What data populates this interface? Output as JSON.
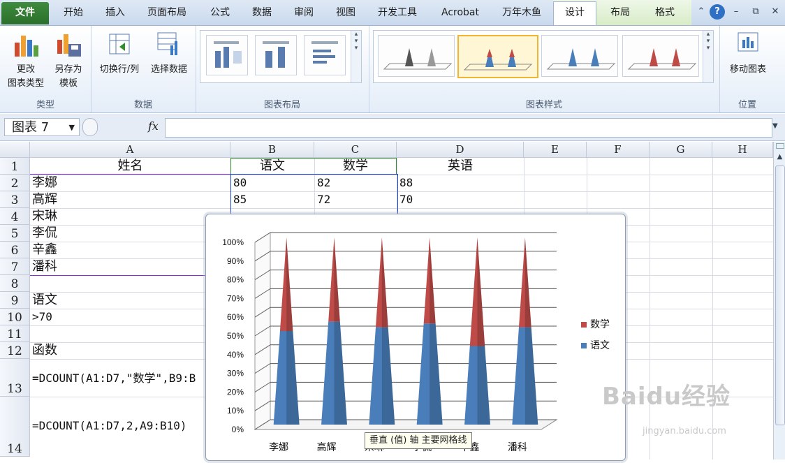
{
  "tabs": [
    "文件",
    "开始",
    "插入",
    "页面布局",
    "公式",
    "数据",
    "审阅",
    "视图",
    "开发工具",
    "Acrobat",
    "万年木鱼",
    "设计",
    "布局",
    "格式"
  ],
  "active_tab": "设计",
  "ribbon": {
    "groups": {
      "type": {
        "label": "类型",
        "change_type": "更改\n图表类型",
        "save_template": "另存为\n模板"
      },
      "data": {
        "label": "数据",
        "switch_row_col": "切换行/列",
        "select_data": "选择数据"
      },
      "layout": {
        "label": "图表布局"
      },
      "styles": {
        "label": "图表样式"
      },
      "location": {
        "label": "位置",
        "move_chart": "移动图表"
      }
    }
  },
  "formula_bar": {
    "name_box": "图表 7",
    "fx": "fx",
    "formula": ""
  },
  "columns": [
    "A",
    "B",
    "C",
    "D",
    "E",
    "F",
    "G",
    "H"
  ],
  "rows": [
    "1",
    "2",
    "3",
    "4",
    "5",
    "6",
    "7",
    "8",
    "9",
    "10",
    "11",
    "12",
    "13",
    "14"
  ],
  "cells": {
    "A1": "姓名",
    "B1": "语文",
    "C1": "数学",
    "D1": "英语",
    "A2": "李娜",
    "B2": "80",
    "C2": "82",
    "D2": "88",
    "A3": "高辉",
    "B3": "85",
    "C3": "72",
    "D3": "70",
    "A4": "宋琳",
    "A5": "李侃",
    "A6": "辛鑫",
    "A7": "潘科",
    "A9": "语文",
    "A10": ">70",
    "A12": "函数",
    "A13": "=DCOUNT(A1:D7,\"数学\",B9:B",
    "A14": "=DCOUNT(A1:D7,2,A9:B10)"
  },
  "chart_data": {
    "type": "bar",
    "stacked": "100%",
    "shape": "cone",
    "categories": [
      "李娜",
      "高辉",
      "宋琳",
      "李侃",
      "辛鑫",
      "潘科"
    ],
    "category_labels_visible": [
      "李娜",
      "高辉",
      "宋琳",
      "李侃",
      "辛鑫",
      "潘科"
    ],
    "y_ticks": [
      "0%",
      "10%",
      "20%",
      "30%",
      "40%",
      "50%",
      "60%",
      "70%",
      "80%",
      "90%",
      "100%"
    ],
    "ylim": [
      0,
      100
    ],
    "series": [
      {
        "name": "语文",
        "color": "#4a7ebb",
        "values": [
          50,
          55,
          52,
          54,
          42,
          52
        ]
      },
      {
        "name": "数学",
        "color": "#be4b48",
        "values": [
          50,
          45,
          48,
          46,
          58,
          48
        ]
      }
    ],
    "legend": [
      "数学",
      "语文"
    ],
    "legend_position": "right",
    "grid": true
  },
  "tooltip": "垂直 (值) 轴 主要网格线",
  "watermark": {
    "text": "Baidu经验",
    "url": "jingyan.baidu.com"
  }
}
